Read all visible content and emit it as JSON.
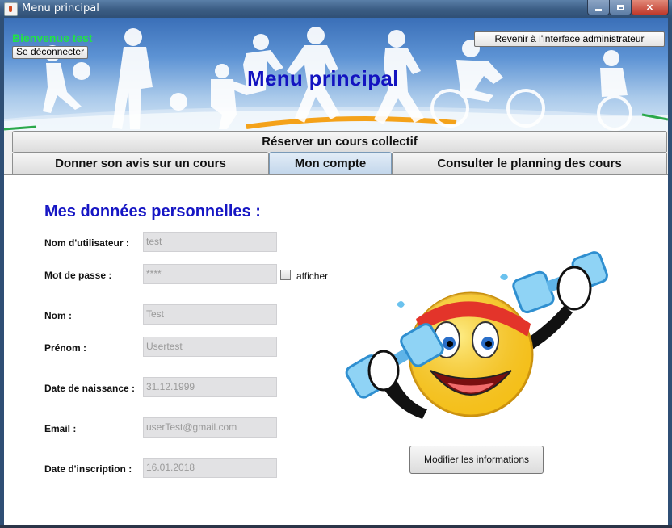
{
  "window": {
    "title": "Menu principal"
  },
  "banner": {
    "welcome": "Bienvenue test",
    "logout_label": "Se déconnecter",
    "admin_label": "Revenir à l'interface administrateur",
    "title": "Menu principal"
  },
  "tabs": {
    "reserve": "Réserver un cours collectif",
    "avis": "Donner son avis sur un cours",
    "compte": "Mon compte",
    "planning": "Consulter le planning des cours"
  },
  "content": {
    "section_title": "Mes données personnelles :",
    "fields": [
      {
        "label": "Nom d'utilisateur :",
        "value": "test"
      },
      {
        "label": "Mot de passe :",
        "value": "****"
      },
      {
        "label": "Nom :",
        "value": "Test"
      },
      {
        "label": "Prénom :",
        "value": "Usertest"
      },
      {
        "label": "Date de naissance :",
        "value": "31.12.1999"
      },
      {
        "label": "Email :",
        "value": "userTest@gmail.com"
      },
      {
        "label": "Date d'inscription :",
        "value": "16.01.2018"
      }
    ],
    "show_password_label": "afficher",
    "modify_label": "Modifier les informations"
  },
  "colors": {
    "accent_title": "#1616c4",
    "welcome": "#22e04a",
    "banner_title": "#1313c0"
  }
}
